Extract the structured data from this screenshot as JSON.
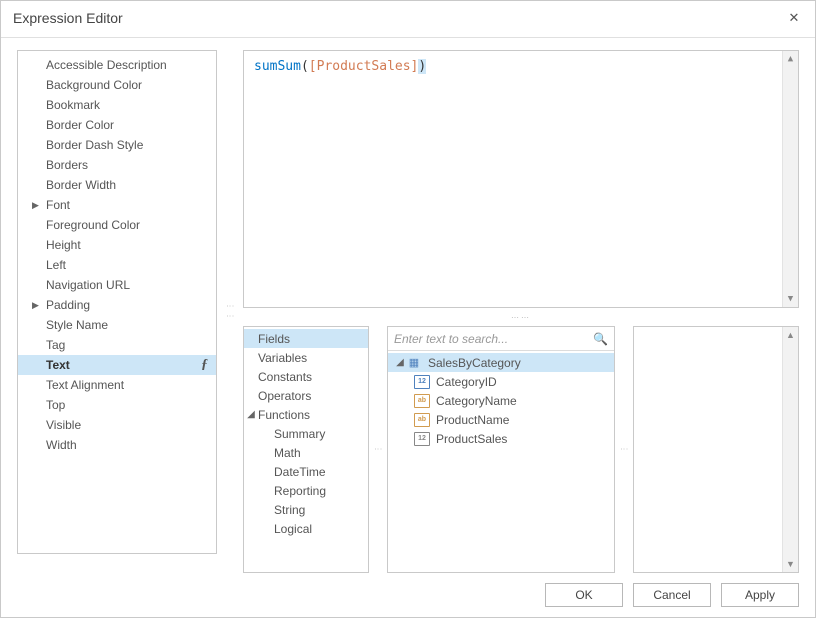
{
  "title": "Expression Editor",
  "expression": {
    "fn": "sumSum",
    "field": "[ProductSales]"
  },
  "properties": [
    {
      "label": "Accessible Description",
      "expand": false,
      "selected": false
    },
    {
      "label": "Background Color",
      "expand": false,
      "selected": false
    },
    {
      "label": "Bookmark",
      "expand": false,
      "selected": false
    },
    {
      "label": "Border Color",
      "expand": false,
      "selected": false
    },
    {
      "label": "Border Dash Style",
      "expand": false,
      "selected": false
    },
    {
      "label": "Borders",
      "expand": false,
      "selected": false
    },
    {
      "label": "Border Width",
      "expand": false,
      "selected": false
    },
    {
      "label": "Font",
      "expand": true,
      "selected": false
    },
    {
      "label": "Foreground Color",
      "expand": false,
      "selected": false
    },
    {
      "label": "Height",
      "expand": false,
      "selected": false
    },
    {
      "label": "Left",
      "expand": false,
      "selected": false
    },
    {
      "label": "Navigation URL",
      "expand": false,
      "selected": false
    },
    {
      "label": "Padding",
      "expand": true,
      "selected": false
    },
    {
      "label": "Style Name",
      "expand": false,
      "selected": false
    },
    {
      "label": "Tag",
      "expand": false,
      "selected": false
    },
    {
      "label": "Text",
      "expand": false,
      "selected": true,
      "fx": true
    },
    {
      "label": "Text Alignment",
      "expand": false,
      "selected": false
    },
    {
      "label": "Top",
      "expand": false,
      "selected": false
    },
    {
      "label": "Visible",
      "expand": false,
      "selected": false
    },
    {
      "label": "Width",
      "expand": false,
      "selected": false
    }
  ],
  "categories": [
    {
      "label": "Fields",
      "selected": true
    },
    {
      "label": "Variables"
    },
    {
      "label": "Constants"
    },
    {
      "label": "Operators"
    },
    {
      "label": "Functions",
      "expanded": true,
      "children": [
        {
          "label": "Summary"
        },
        {
          "label": "Math"
        },
        {
          "label": "DateTime"
        },
        {
          "label": "Reporting"
        },
        {
          "label": "String"
        },
        {
          "label": "Logical"
        }
      ]
    }
  ],
  "search": {
    "placeholder": "Enter text to search..."
  },
  "fieldsTree": {
    "root": {
      "label": "SalesByCategory",
      "selected": true
    },
    "children": [
      {
        "label": "CategoryID",
        "icon": "12"
      },
      {
        "label": "CategoryName",
        "icon": "ab"
      },
      {
        "label": "ProductName",
        "icon": "ab"
      },
      {
        "label": "ProductSales",
        "icon": "12g"
      }
    ]
  },
  "buttons": {
    "ok": "OK",
    "cancel": "Cancel",
    "apply": "Apply"
  }
}
